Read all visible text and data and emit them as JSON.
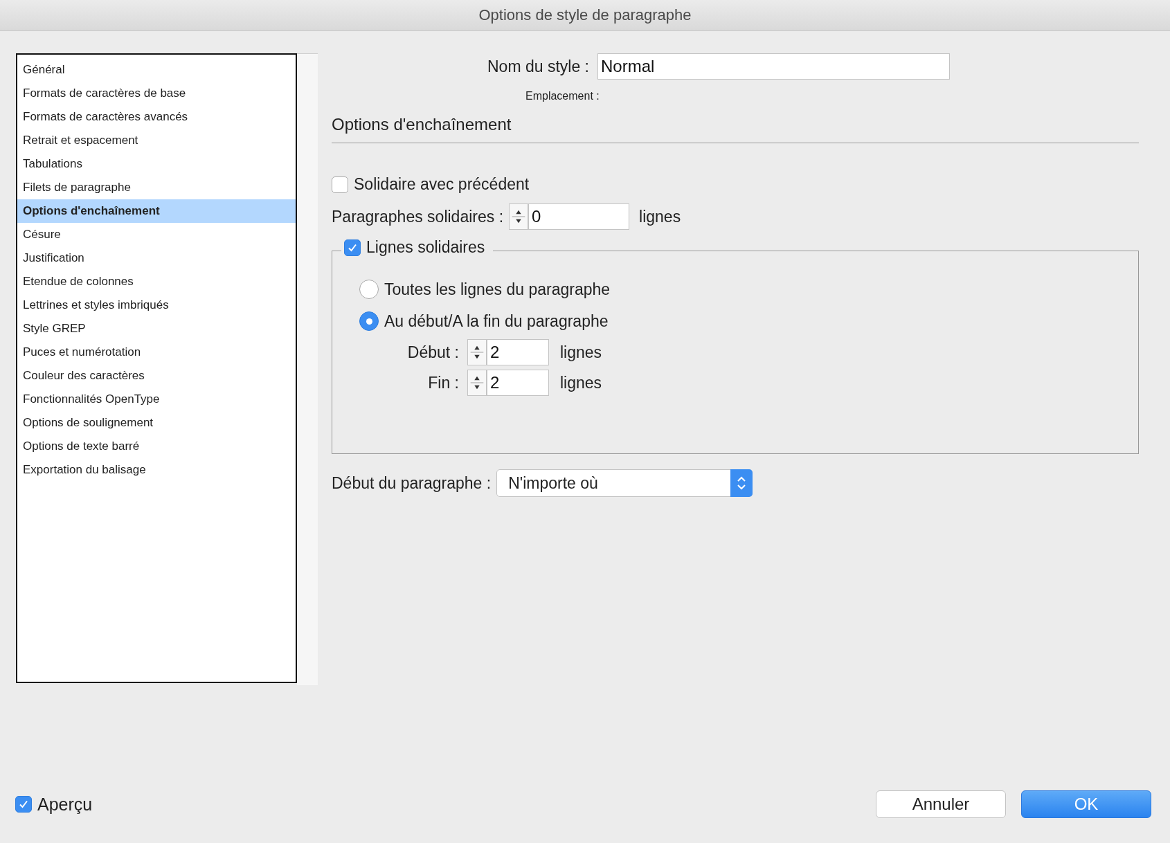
{
  "window": {
    "title": "Options de style de paragraphe"
  },
  "sidebar": {
    "items": [
      {
        "label": "Général",
        "selected": false
      },
      {
        "label": "Formats de caractères de base",
        "selected": false
      },
      {
        "label": "Formats de caractères avancés",
        "selected": false
      },
      {
        "label": "Retrait et espacement",
        "selected": false
      },
      {
        "label": "Tabulations",
        "selected": false
      },
      {
        "label": "Filets de paragraphe",
        "selected": false
      },
      {
        "label": "Options d'enchaînement",
        "selected": true
      },
      {
        "label": "Césure",
        "selected": false
      },
      {
        "label": "Justification",
        "selected": false
      },
      {
        "label": "Etendue de colonnes",
        "selected": false
      },
      {
        "label": "Lettrines et styles imbriqués",
        "selected": false
      },
      {
        "label": "Style GREP",
        "selected": false
      },
      {
        "label": "Puces et numérotation",
        "selected": false
      },
      {
        "label": "Couleur des caractères",
        "selected": false
      },
      {
        "label": "Fonctionnalités OpenType",
        "selected": false
      },
      {
        "label": "Options de soulignement",
        "selected": false
      },
      {
        "label": "Options de texte barré",
        "selected": false
      },
      {
        "label": "Exportation du balisage",
        "selected": false
      }
    ]
  },
  "style_name": {
    "label": "Nom du style :",
    "value": "Normal"
  },
  "location": {
    "label": "Emplacement :"
  },
  "section": {
    "title": "Options d'enchaînement"
  },
  "keep_with_previous": {
    "label": "Solidaire avec précédent",
    "checked": false
  },
  "keep_with_next": {
    "label": "Paragraphes solidaires :",
    "value": "0",
    "unit": "lignes"
  },
  "keep_lines": {
    "label": "Lignes solidaires",
    "checked": true,
    "options": [
      {
        "label": "Toutes les lignes du paragraphe",
        "selected": false
      },
      {
        "label": "Au début/A la fin du paragraphe",
        "selected": true
      }
    ],
    "fields": [
      {
        "label": "Début :",
        "value": "2",
        "unit": "lignes"
      },
      {
        "label": "Fin :",
        "value": "2",
        "unit": "lignes"
      }
    ]
  },
  "start_paragraph": {
    "label": "Début du paragraphe :",
    "value": "N'importe où"
  },
  "preview": {
    "label": "Aperçu",
    "checked": true
  },
  "buttons": [
    {
      "label": "Annuler",
      "kind": "secondary"
    },
    {
      "label": "OK",
      "kind": "primary"
    }
  ]
}
